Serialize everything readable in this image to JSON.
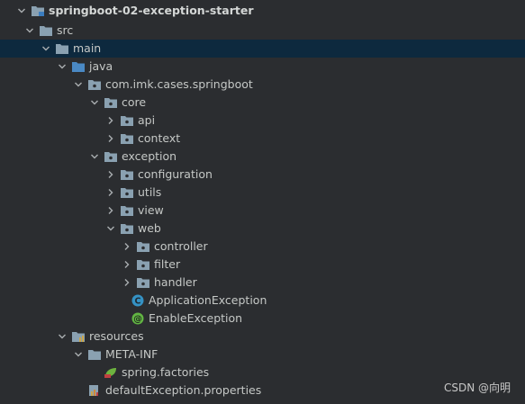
{
  "tree": {
    "items": [
      {
        "label": "springboot-02-exception-starter"
      },
      {
        "label": "src"
      },
      {
        "label": "main"
      },
      {
        "label": "java"
      },
      {
        "label": "com.imk.cases.springboot"
      },
      {
        "label": "core"
      },
      {
        "label": "api"
      },
      {
        "label": "context"
      },
      {
        "label": "exception"
      },
      {
        "label": "configuration"
      },
      {
        "label": "utils"
      },
      {
        "label": "view"
      },
      {
        "label": "web"
      },
      {
        "label": "controller"
      },
      {
        "label": "filter"
      },
      {
        "label": "handler"
      },
      {
        "label": "ApplicationException"
      },
      {
        "label": "EnableException"
      },
      {
        "label": "resources"
      },
      {
        "label": "META-INF"
      },
      {
        "label": "spring.factories"
      },
      {
        "label": "defaultException.properties"
      }
    ]
  },
  "watermark": "CSDN @向明",
  "colors": {
    "background": "#2b2d30",
    "selection": "#0d293e",
    "folder": "#8aa1b1",
    "source_folder": "#4a89c4",
    "class_icon": "#3592c4",
    "annotation_icon": "#62b543"
  }
}
